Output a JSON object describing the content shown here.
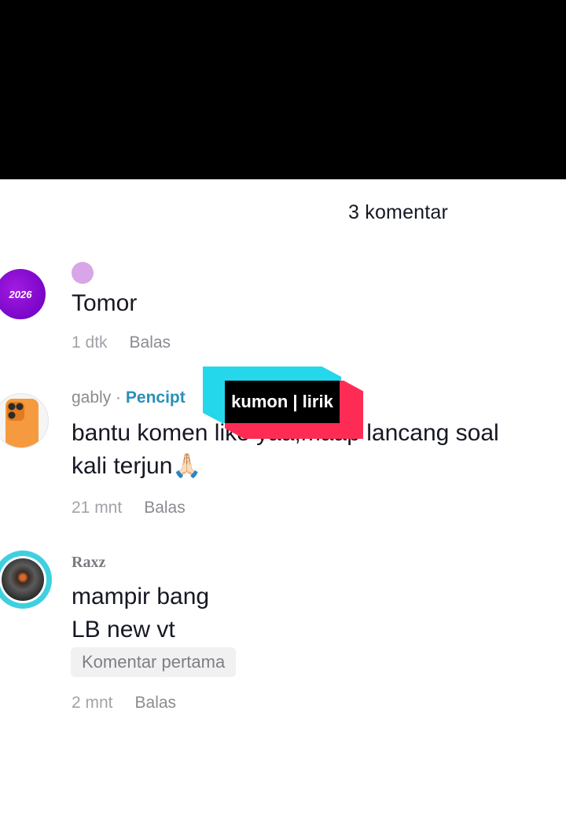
{
  "header": {
    "comment_count": "3 komentar"
  },
  "comments": [
    {
      "avatar_text": "2026",
      "username": "",
      "text": "Tomor",
      "time": "1 dtk",
      "reply_label": "Balas"
    },
    {
      "avatar_icon": "phone-icon",
      "username": "gably",
      "separator": "·",
      "creator_tag": "Pencipt",
      "text": "bantu komen like yaa,maap lancang soal\nkali terjun🙏🏻",
      "time": "21 mnt",
      "reply_label": "Balas"
    },
    {
      "avatar_icon": "camera-lens-icon",
      "username": "Raxz",
      "text": "mampir bang\nLB new vt",
      "badge": "Komentar pertama",
      "time": "2 mnt",
      "reply_label": "Balas"
    }
  ],
  "watermark": {
    "text": "kumon | lirik"
  },
  "colors": {
    "accent_cyan": "#25d7eb",
    "accent_red": "#fe2c55",
    "creator_tag": "#2b8fb8"
  }
}
